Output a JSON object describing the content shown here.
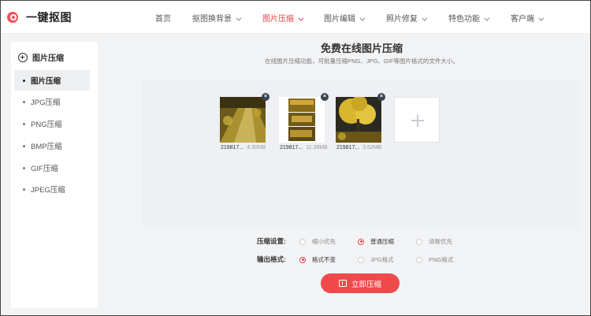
{
  "header": {
    "logo_text": "一键抠图",
    "nav": [
      {
        "label": "首页",
        "chevron": false,
        "active": false
      },
      {
        "label": "抠图换背景",
        "chevron": true,
        "active": false
      },
      {
        "label": "图片压缩",
        "chevron": true,
        "active": true
      },
      {
        "label": "图片编辑",
        "chevron": true,
        "active": false
      },
      {
        "label": "照片修复",
        "chevron": true,
        "active": false
      },
      {
        "label": "特色功能",
        "chevron": true,
        "active": false
      },
      {
        "label": "客户端",
        "chevron": true,
        "active": false
      }
    ]
  },
  "sidebar": {
    "title": "图片压缩",
    "items": [
      {
        "label": "图片压缩",
        "active": true
      },
      {
        "label": "JPG压缩",
        "active": false
      },
      {
        "label": "PNG压缩",
        "active": false
      },
      {
        "label": "BMP压缩",
        "active": false
      },
      {
        "label": "GIF压缩",
        "active": false
      },
      {
        "label": "JPEG压缩",
        "active": false
      }
    ]
  },
  "main": {
    "title": "免费在线图片压缩",
    "subtitle": "在线图片压缩功能，可批量压缩PNG、JPG、GIF等图片格式的文件大小。",
    "files": [
      {
        "name": "219817...",
        "size": "4.30MB",
        "icon": "ginkgo-path-photo"
      },
      {
        "name": "219817...",
        "size": "11.38MB",
        "icon": "ginkgo-collage-photo"
      },
      {
        "name": "219817...",
        "size": "3.52MB",
        "icon": "ginkgo-tree-photo"
      }
    ],
    "add_icon": "plus-icon",
    "compression_settings": {
      "label": "压缩设置:",
      "options": [
        {
          "label": "缩小优先",
          "selected": false
        },
        {
          "label": "普通压缩",
          "selected": true
        },
        {
          "label": "清晰优先",
          "selected": false
        }
      ]
    },
    "output_format": {
      "label": "输出格式:",
      "options": [
        {
          "label": "格式不变",
          "selected": true
        },
        {
          "label": "JPG格式",
          "selected": false
        },
        {
          "label": "PNG格式",
          "selected": false
        }
      ]
    },
    "compress_button": "立即压缩"
  },
  "colors": {
    "accent": "#ef4a4a",
    "active_nav": "#e8424a",
    "upload_bg": "#eef0f4"
  }
}
